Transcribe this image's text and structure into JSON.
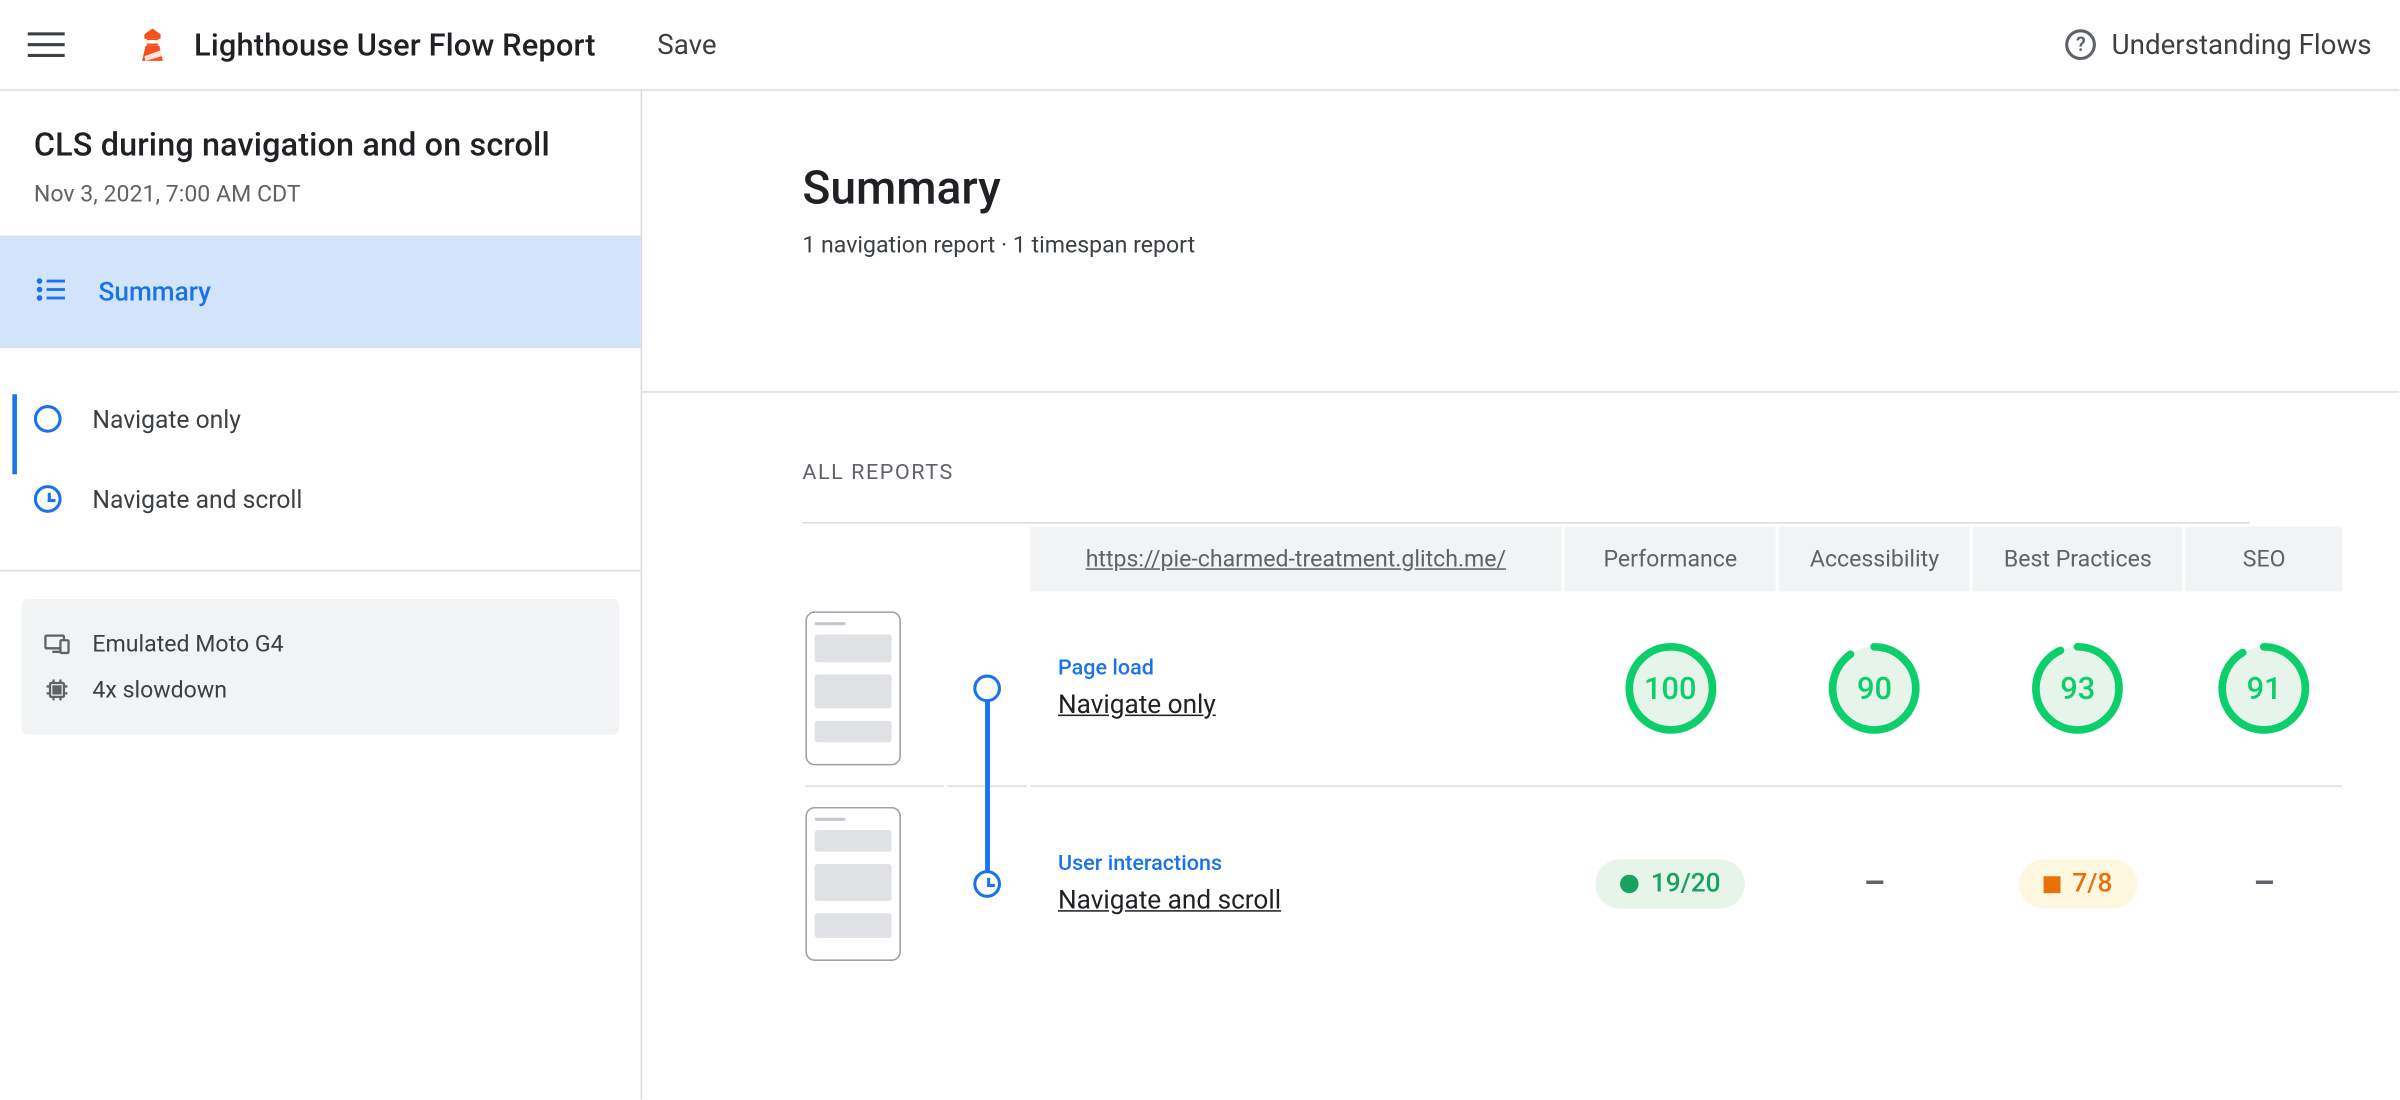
{
  "topbar": {
    "app_title": "Lighthouse User Flow Report",
    "save_label": "Save",
    "help_label": "Understanding Flows"
  },
  "sidebar": {
    "flow_title": "CLS during navigation and on scroll",
    "flow_date": "Nov 3, 2021, 7:00 AM CDT",
    "summary_label": "Summary",
    "steps": [
      {
        "label": "Navigate only",
        "type": "navigation"
      },
      {
        "label": "Navigate and scroll",
        "type": "timespan"
      }
    ],
    "env": {
      "device": "Emulated Moto G4",
      "throttling": "4x slowdown"
    }
  },
  "main": {
    "heading": "Summary",
    "subheading": "1 navigation report · 1 timespan report",
    "all_reports_label": "ALL REPORTS",
    "url": "https://pie-charmed-treatment.glitch.me/",
    "columns": {
      "performance": "Performance",
      "accessibility": "Accessibility",
      "best_practices": "Best Practices",
      "seo": "SEO"
    },
    "rows": [
      {
        "kind_label": "Page load",
        "name": "Navigate only",
        "marker": "navigation",
        "scores": {
          "performance": {
            "display": "100",
            "value": 100,
            "type": "gauge"
          },
          "accessibility": {
            "display": "90",
            "value": 90,
            "type": "gauge"
          },
          "best_practices": {
            "display": "93",
            "value": 93,
            "type": "gauge"
          },
          "seo": {
            "display": "91",
            "value": 91,
            "type": "gauge"
          }
        }
      },
      {
        "kind_label": "User interactions",
        "name": "Navigate and scroll",
        "marker": "timespan",
        "scores": {
          "performance": {
            "display": "19/20",
            "type": "pill",
            "variant": "pass"
          },
          "accessibility": {
            "display": "–",
            "type": "dash"
          },
          "best_practices": {
            "display": "7/8",
            "type": "pill",
            "variant": "avg"
          },
          "seo": {
            "display": "–",
            "type": "dash"
          }
        }
      }
    ]
  },
  "colors": {
    "blue": "#1a73e8",
    "green": "#0cce6b",
    "orange": "#e8710a"
  }
}
